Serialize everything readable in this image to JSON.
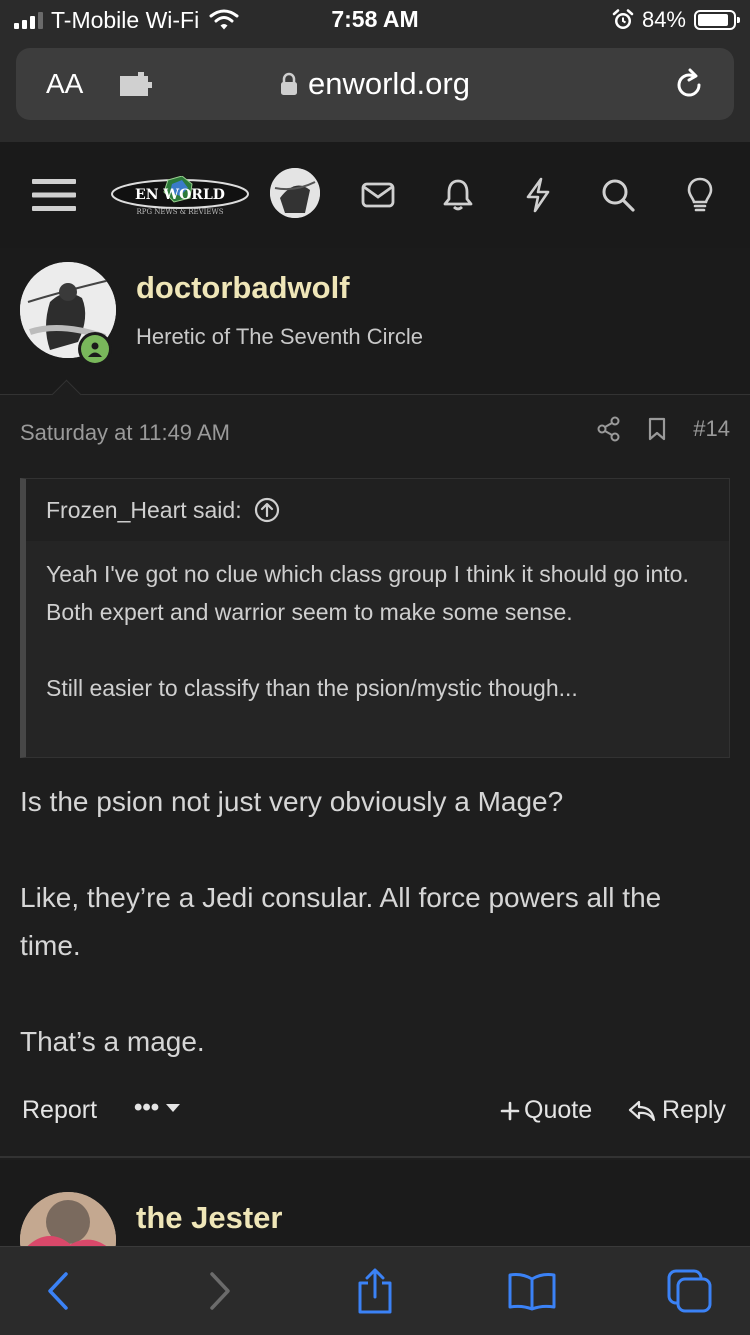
{
  "status_bar": {
    "carrier": "T-Mobile Wi-Fi",
    "time": "7:58 AM",
    "battery": "84%"
  },
  "browser": {
    "text_size_label": "AA",
    "url": "enworld.org"
  },
  "site": {
    "logo_text": "EN WORLD",
    "logo_subtext": "RPG NEWS & REVIEWS"
  },
  "post": {
    "username": "doctorbadwolf",
    "user_title": "Heretic of The Seventh Circle",
    "date": "Saturday at 11:49 AM",
    "post_number": "#14",
    "quote": {
      "author": "Frozen_Heart said:",
      "paragraphs": [
        "Yeah I've got no clue which class group I think it should go into. Both expert and warrior seem to make some sense.",
        "Still easier to classify than the psion/mystic though..."
      ]
    },
    "message": [
      "Is the psion not just very obviously a Mage?",
      "Like, they’re a Jedi consular. All force powers all the time.",
      "That’s a mage."
    ],
    "actions": {
      "report": "Report",
      "more": "•••",
      "quote": "Quote",
      "reply": "Reply"
    }
  },
  "next_post": {
    "username": "the Jester"
  },
  "colors": {
    "background": "#1e1e1e",
    "username": "#efe6b8",
    "online": "#79b85b",
    "browser_accent": "#3b82f6"
  }
}
